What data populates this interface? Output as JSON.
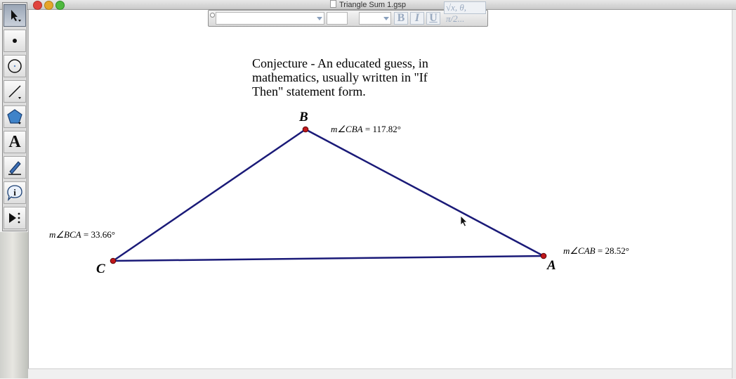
{
  "window": {
    "title": "Triangle Sum 1.gsp"
  },
  "toolbox": {
    "tools": [
      {
        "name": "arrow-tool-icon"
      },
      {
        "name": "point-tool-icon"
      },
      {
        "name": "compass-tool-icon"
      },
      {
        "name": "straightedge-tool-icon"
      },
      {
        "name": "polygon-tool-icon"
      },
      {
        "name": "text-tool-icon",
        "glyph": "A"
      },
      {
        "name": "marker-tool-icon"
      },
      {
        "name": "information-tool-icon",
        "glyph": "i"
      },
      {
        "name": "custom-tool-icon"
      }
    ]
  },
  "format_bar": {
    "bold": "B",
    "italic": "I",
    "underline": "U",
    "math": "√x, θ, π/2..."
  },
  "conjecture": {
    "line1": "Conjecture - An educated guess, in",
    "line2": "mathematics, usually written in \"If",
    "line3": "Then\" statement form."
  },
  "vertices": {
    "a": "A",
    "b": "B",
    "c": "C"
  },
  "measurements": {
    "cba": {
      "prefix": "m∠CBA",
      "value": "= 117.82°"
    },
    "bca": {
      "prefix": "m∠BCA",
      "value": "= 33.66°"
    },
    "cab": {
      "prefix": "m∠CAB",
      "value": "= 28.52°"
    }
  },
  "colors": {
    "segment": "#1a1a78",
    "point": "#c0171b"
  }
}
